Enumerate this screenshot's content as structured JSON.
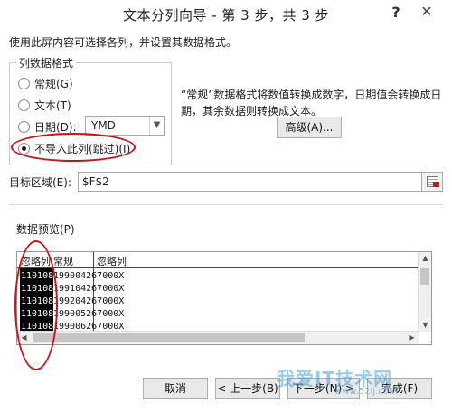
{
  "dialog": {
    "title": "文本分列向导 - 第 3 步，共 3 步",
    "help_label": "?",
    "close_label": "✕",
    "instruction": "使用此屏内容可选择各列，并设置其数据格式。"
  },
  "column_format": {
    "legend": "列数据格式",
    "options": [
      {
        "label": "常规(G)",
        "checked": false
      },
      {
        "label": "文本(T)",
        "checked": false
      },
      {
        "label": "日期(D):",
        "checked": false
      },
      {
        "label": "不导入此列(跳过)(I)",
        "checked": true
      }
    ],
    "date_format": "YMD"
  },
  "description": "“常规”数据格式将数值转换成数字，日期值会转换成日期，其余数据则转换成文本。",
  "advanced_button": "高级(A)...",
  "target": {
    "label": "目标区域(E):",
    "value": "$F$2"
  },
  "preview": {
    "label": "数据预览(P)",
    "headers": [
      "忽略列",
      "常规",
      "忽略列"
    ],
    "rows": [
      {
        "c1": "110108",
        "c2": "19900426",
        "c3": "7000X"
      },
      {
        "c1": "110108",
        "c2": "19910426",
        "c3": "7000X"
      },
      {
        "c1": "110108",
        "c2": "19920426",
        "c3": "7000X"
      },
      {
        "c1": "110108",
        "c2": "19900526",
        "c3": "7000X"
      },
      {
        "c1": "110108",
        "c2": "19900626",
        "c3": "7000X"
      }
    ]
  },
  "buttons": {
    "cancel": "取消",
    "back": "< 上一步(B)",
    "next": "下一步(N) >",
    "finish": "完成(F)"
  },
  "watermark": {
    "text": "我爱IT技术网",
    "url": "www.52ij.com"
  },
  "colors": {
    "annotation_red": "#c8141c",
    "watermark_blue": "#46a0dc"
  }
}
